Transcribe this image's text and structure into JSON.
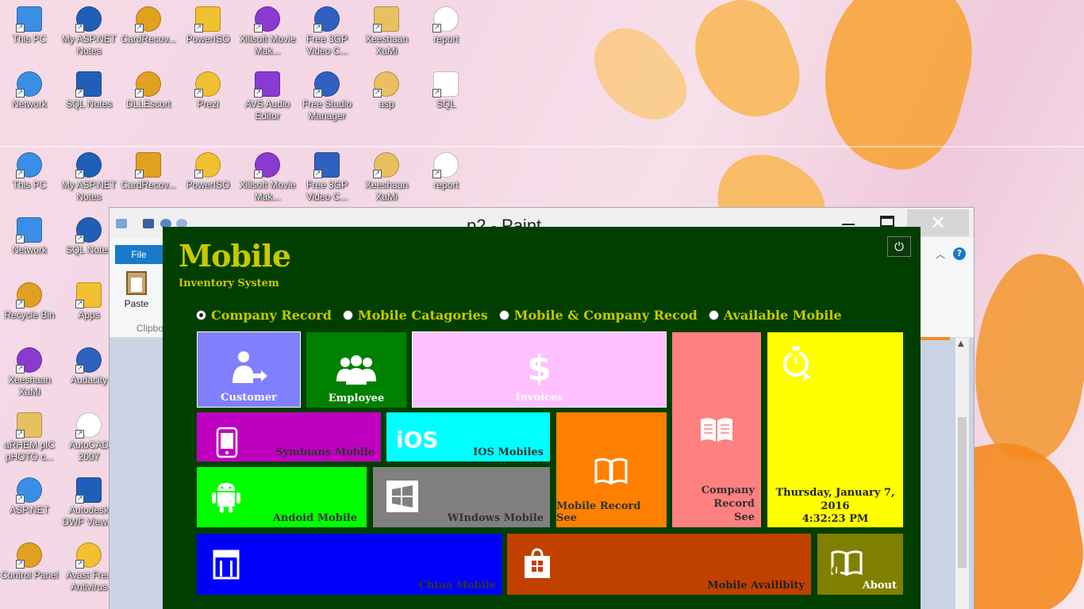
{
  "desktop": {
    "icons": [
      {
        "label": "This PC"
      },
      {
        "label": "My ASP.NET Notes"
      },
      {
        "label": "CardRecov..."
      },
      {
        "label": "PowerISO"
      },
      {
        "label": "Xilisoft Movie Mak..."
      },
      {
        "label": "Free 3GP Video C..."
      },
      {
        "label": "Xeeshaan XaMi"
      },
      {
        "label": "report"
      },
      {
        "label": "Network"
      },
      {
        "label": "SQL Notes"
      },
      {
        "label": "DLLEscort"
      },
      {
        "label": "Prezi"
      },
      {
        "label": "AVS Audio Editor"
      },
      {
        "label": "Free Studio Manager"
      },
      {
        "label": "asp"
      },
      {
        "label": "SQL"
      },
      {
        "label": "This PC"
      },
      {
        "label": "My ASP.NET Notes"
      },
      {
        "label": "CardRecov..."
      },
      {
        "label": "PowerISO"
      },
      {
        "label": "Xilisoft Movie Mak..."
      },
      {
        "label": "Free 3GP Video C..."
      },
      {
        "label": "Xeeshaan XaMi"
      },
      {
        "label": "report"
      },
      {
        "label": "Network"
      },
      {
        "label": "SQL Notes"
      },
      {
        "label": "Recycle Bin"
      },
      {
        "label": "Apps"
      },
      {
        "label": "Xeeshaan XaMi"
      },
      {
        "label": "Audacity"
      },
      {
        "label": "aRHEM pIC pHOTO c..."
      },
      {
        "label": "AutoCAD 2007"
      },
      {
        "label": "ASP.NET"
      },
      {
        "label": "Autodesk DWF Viewer"
      },
      {
        "label": "Control Panel"
      },
      {
        "label": "Avast Free Antivirus"
      },
      {
        "label": "This PC"
      },
      {
        "label": "Network"
      },
      {
        "label": "Recycle B"
      },
      {
        "label": "Xeeshaa XaMi"
      }
    ]
  },
  "paint": {
    "title": "p2 - Paint",
    "file_tab": "File",
    "paste_label": "Paste",
    "clipboard_label": "Clipbo",
    "close_glyph": "✕",
    "help_glyph": "?"
  },
  "app": {
    "title": "Mobile",
    "subtitle": "Inventory System",
    "power_glyph": "⏻",
    "radios": [
      {
        "label": "Company Record",
        "checked": true
      },
      {
        "label": "Mobile Catagories",
        "checked": false
      },
      {
        "label": "Mobile & Company Recod",
        "checked": false
      },
      {
        "label": "Available Mobile",
        "checked": false
      }
    ],
    "tiles": {
      "customer": {
        "label": "Customer",
        "color": "#8080ff",
        "icon": "customer-icon"
      },
      "employee": {
        "label": "Employee",
        "color": "#008000",
        "icon": "employee-group-icon"
      },
      "invoices": {
        "label": "Invoices",
        "color": "#ffc0ff",
        "icon": "dollar-icon",
        "glyph": "$"
      },
      "company_record": {
        "label": "Company Record See",
        "color": "#ff8080",
        "icon": "book-icon"
      },
      "clock": {
        "date": "Thursday, January 7, 2016",
        "time": "4:32:23 PM",
        "color": "#ffff00",
        "icon": "timer-icon"
      },
      "symbians": {
        "label": "Symbians Mobile",
        "color": "#c000c0",
        "icon": "phone-icon"
      },
      "ios": {
        "label": "IOS Mobiles",
        "color": "#00ffff",
        "icon": "ios-icon",
        "glyph": "iOS"
      },
      "mobile_record": {
        "label": "Mobile Record See",
        "color": "#ff8000",
        "icon": "open-book-icon"
      },
      "android": {
        "label": "Andoid Mobile",
        "color": "#00ff00",
        "icon": "android-icon"
      },
      "windows": {
        "label": "WIndows Mobile",
        "color": "#808080",
        "icon": "windows-icon"
      },
      "china": {
        "label": "China Mobile",
        "color": "#0000ff",
        "icon": "grid-icon"
      },
      "availability": {
        "label": "Mobile Availibity",
        "color": "#c04000",
        "icon": "store-icon"
      },
      "about": {
        "label": "About",
        "color": "#808000",
        "icon": "info-book-icon"
      }
    }
  }
}
